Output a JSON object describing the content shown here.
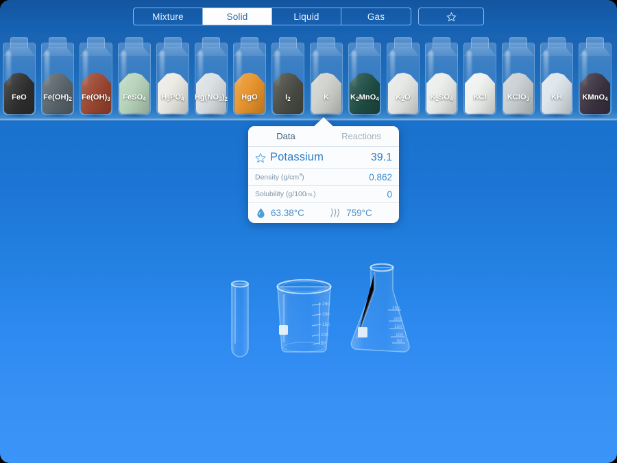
{
  "topbar": {
    "segments": [
      {
        "label": "Mixture",
        "active": false
      },
      {
        "label": "Solid",
        "active": true
      },
      {
        "label": "Liquid",
        "active": false
      },
      {
        "label": "Gas",
        "active": false
      }
    ],
    "favorites_icon": "star-icon"
  },
  "shelf": {
    "jars": [
      {
        "label": "FeO",
        "formula_html": "FeO",
        "color": "#2e2f2e"
      },
      {
        "label": "Fe(OH)2",
        "formula_html": "Fe(OH)<sub>2</sub>",
        "color": "#5a656c"
      },
      {
        "label": "Fe(OH)3",
        "formula_html": "Fe(OH)<sub>3</sub>",
        "color": "#9c4630"
      },
      {
        "label": "FeSO4",
        "formula_html": "FeSO<sub>4</sub>",
        "color": "#b7d4bb"
      },
      {
        "label": "H3PO4",
        "formula_html": "H<sub>3</sub>PO<sub>4</sub>",
        "color": "#eceae5"
      },
      {
        "label": "Hg(NO3)2",
        "formula_html": "Hg(NO<sub>3</sub>)<sub>2</sub>",
        "color": "#dbe0e3"
      },
      {
        "label": "HgO",
        "formula_html": "HgO",
        "color": "#e8942a"
      },
      {
        "label": "I2",
        "formula_html": "I<sub>2</sub>",
        "color": "#4a4c45"
      },
      {
        "label": "K",
        "formula_html": "K",
        "color": "#cfd2cd",
        "selected": true
      },
      {
        "label": "K2MnO4",
        "formula_html": "K<sub>2</sub>MnO<sub>4</sub>",
        "color": "#1f4d45"
      },
      {
        "label": "K2O",
        "formula_html": "K<sub>2</sub>O",
        "color": "#e6e8e6"
      },
      {
        "label": "K2SO4",
        "formula_html": "K<sub>2</sub>SO<sub>4</sub>",
        "color": "#eceeeb"
      },
      {
        "label": "KCl",
        "formula_html": "KCl",
        "color": "#f0f2f0"
      },
      {
        "label": "KClO3",
        "formula_html": "KClO<sub>3</sub>",
        "color": "#c9cfd2"
      },
      {
        "label": "KH",
        "formula_html": "KH",
        "color": "#dde6ec"
      },
      {
        "label": "KMnO4",
        "formula_html": "KMnO<sub>4</sub>",
        "color": "#3b3340"
      },
      {
        "label": "",
        "formula_html": "",
        "color": "#e9ebe8"
      }
    ]
  },
  "popup": {
    "tabs": [
      {
        "label": "Data",
        "active": true
      },
      {
        "label": "Reactions",
        "active": false
      }
    ],
    "favorite_icon": "star-icon",
    "substance_name": "Potassium",
    "molar_mass": "39.1",
    "properties": [
      {
        "key_html": "Density (g/cm<sup>3</sup>)",
        "key_text": "Density (g/cm3)",
        "value": "0.862"
      },
      {
        "key_html": "Solubility (g/100<span class=\"sm\">mL</span>)",
        "key_text": "Solubility (g/100mL)",
        "value": "0"
      }
    ],
    "melting_point": "63.38°C",
    "boiling_point": "759°C",
    "melting_icon": "water-drop-icon",
    "boiling_icon": "steam-icon"
  },
  "glassware": {
    "test_tube": {
      "name": "test-tube"
    },
    "beaker": {
      "name": "beaker",
      "graduations": [
        "250",
        "200",
        "150",
        "100",
        "50"
      ]
    },
    "flask": {
      "name": "erlenmeyer-flask",
      "graduations": [
        "250",
        "200",
        "150",
        "100",
        "50"
      ]
    }
  },
  "colors": {
    "bg_top": "#1560b0",
    "bg_mid": "#1c75d4",
    "bg_bottom": "#3892f5",
    "accent": "#2f7fc4",
    "card_bg": "#fbfcfd"
  }
}
